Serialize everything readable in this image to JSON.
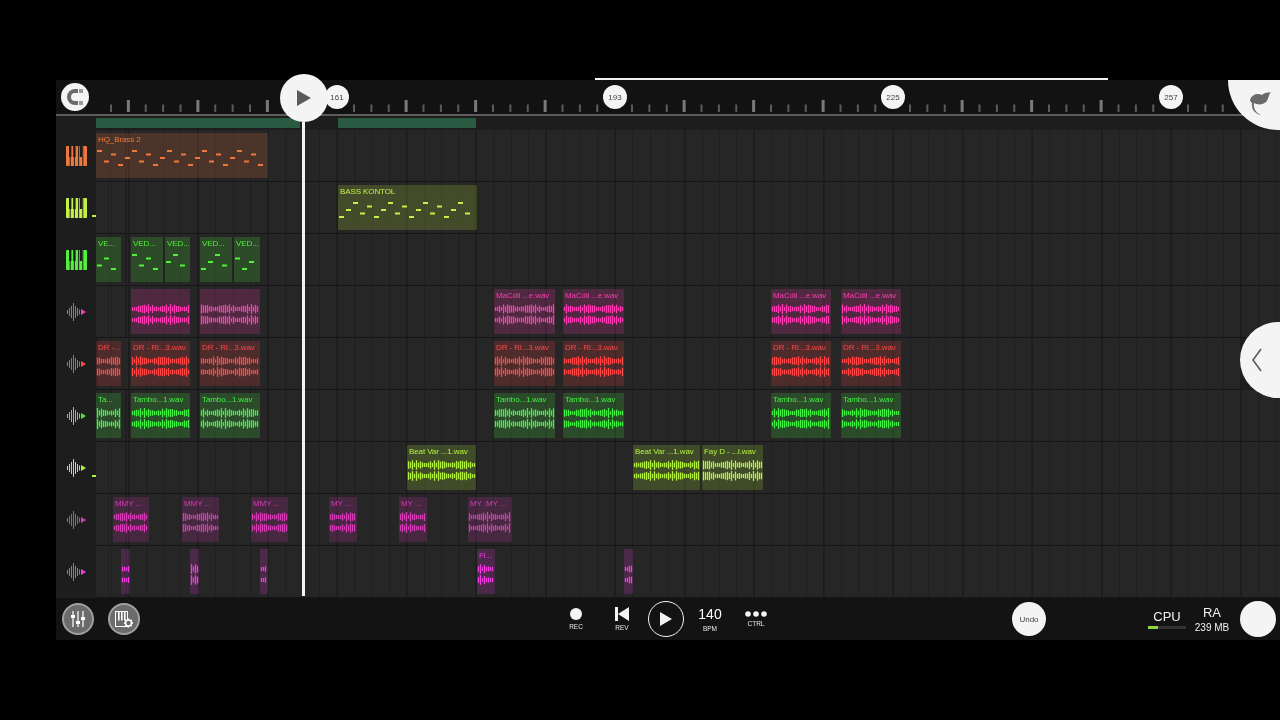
{
  "ruler": {
    "bar_numbers": [
      "161",
      "193",
      "225",
      "257"
    ]
  },
  "tracks": [
    {
      "kind": "instrument",
      "color": "#f0783f",
      "marked": false,
      "clips": [
        {
          "kind": "pattern",
          "label": "HQ_Brass 2"
        }
      ]
    },
    {
      "kind": "instrument",
      "color": "#c2f046",
      "marked": true,
      "clips": [
        {
          "kind": "pattern",
          "label": "BASS KONTOL"
        }
      ]
    },
    {
      "kind": "instrument",
      "color": "#52f03c",
      "marked": false,
      "clips": [
        {
          "kind": "pattern",
          "label": "VE..."
        },
        {
          "kind": "pattern",
          "label": "VED..."
        },
        {
          "kind": "pattern",
          "label": "VED..."
        },
        {
          "kind": "pattern",
          "label": "VED..."
        },
        {
          "kind": "pattern",
          "label": "VED..."
        }
      ]
    },
    {
      "kind": "audio",
      "color": "#ff3cb4",
      "marked": false,
      "clips": [
        {
          "kind": "audio"
        },
        {
          "kind": "audio"
        },
        {
          "kind": "audio",
          "label": "MaCdii ...e.wav"
        },
        {
          "kind": "audio",
          "label": "MaCdii ...e.wav"
        },
        {
          "kind": "audio",
          "label": "MaCdii ...e.wav"
        },
        {
          "kind": "audio",
          "label": "MaCdii ...e.wav"
        }
      ]
    },
    {
      "kind": "audio",
      "color": "#ff4848",
      "marked": false,
      "clips": [
        {
          "kind": "audio",
          "label": "DR -..."
        },
        {
          "kind": "audio",
          "label": "DR - RI...3.wav"
        },
        {
          "kind": "audio",
          "label": "DR - RI...3.wav"
        },
        {
          "kind": "audio",
          "label": "DR - RI...3.wav"
        },
        {
          "kind": "audio",
          "label": "DR - RI...3.wav"
        },
        {
          "kind": "audio",
          "label": "DR - RI...3.wav"
        },
        {
          "kind": "audio",
          "label": "DR - RI...3.wav"
        }
      ]
    },
    {
      "kind": "audio",
      "color": "#44f044",
      "marked": false,
      "clips": [
        {
          "kind": "audio",
          "label": "Ta..."
        },
        {
          "kind": "audio",
          "label": "Tambo...1.wav"
        },
        {
          "kind": "audio",
          "label": "Tambo...1.wav"
        },
        {
          "kind": "audio",
          "label": "Tambo...1.wav"
        },
        {
          "kind": "audio",
          "label": "Tambo...1.wav"
        },
        {
          "kind": "audio",
          "label": "Tambo...1.wav"
        },
        {
          "kind": "audio",
          "label": "Tambo...1.wav"
        }
      ]
    },
    {
      "kind": "audio",
      "color": "#b4f040",
      "marked": true,
      "clips": [
        {
          "kind": "audio",
          "label": "Beat Var ...1.wav"
        },
        {
          "kind": "audio",
          "label": "Beat Var ...1.wav"
        },
        {
          "kind": "audio",
          "label": "Fay D - ...l.wav"
        }
      ]
    },
    {
      "kind": "audio",
      "color": "#d43cb4",
      "marked": false,
      "clips": [
        {
          "kind": "audio",
          "label": "MMY ..."
        },
        {
          "kind": "audio",
          "label": "MMY ..."
        },
        {
          "kind": "audio",
          "label": "MMY ..."
        },
        {
          "kind": "audio",
          "label": "MY ..."
        },
        {
          "kind": "audio",
          "label": "MY ..."
        },
        {
          "kind": "audio",
          "label": "MY .MY ..."
        }
      ]
    },
    {
      "kind": "audio",
      "color": "#f03ce0",
      "marked": false,
      "clips": [
        {
          "kind": "audio"
        },
        {
          "kind": "audio"
        },
        {
          "kind": "audio"
        },
        {
          "kind": "audio",
          "label": "Fl..."
        },
        {
          "kind": "audio"
        }
      ]
    }
  ],
  "transport": [
    {
      "kind": "record",
      "label": "REC"
    },
    {
      "kind": "rewind",
      "label": "REV"
    },
    {
      "kind": "play"
    },
    {
      "kind": "tempo",
      "value": "140",
      "label": "BPM"
    },
    {
      "kind": "more",
      "label": "CTRL"
    }
  ],
  "undo": {
    "label": "Undo"
  },
  "stats": {
    "cpu": {
      "label": "CPU",
      "level": 0.25
    },
    "ram": {
      "label": "RA",
      "value": "239 MB"
    }
  }
}
